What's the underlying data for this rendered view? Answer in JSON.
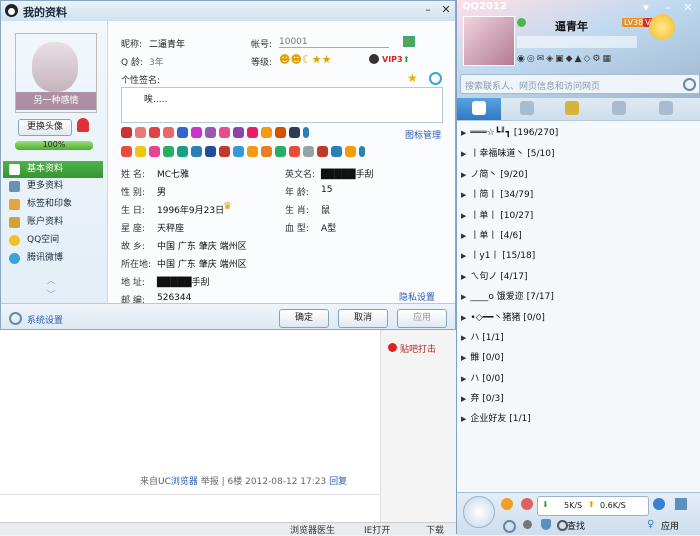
{
  "profile_window": {
    "title": "我的资料",
    "avatar_caption": "另一种感情",
    "change_avatar": "更换头像",
    "completion": "100%",
    "completion_fraction": 1.0,
    "nav": [
      "基本资料",
      "更多资料",
      "标签和印象",
      "账户资料",
      "QQ空间",
      "腾讯微博"
    ],
    "nickname_label": "昵称:",
    "nickname": "二逼青年",
    "account_label": "帐号:",
    "account": "10001",
    "qage_label": "Q 龄:",
    "qage": "3年",
    "level_label": "等级:",
    "vip": "VIP3",
    "signature_label": "个性签名:",
    "signature": "唉.....",
    "icon_manage": "图标管理",
    "fields": {
      "name_label": "姓 名:",
      "name": "MC七雅",
      "en_label": "英文名:",
      "en": "█████手刮",
      "gender_label": "性 别:",
      "gender": "男",
      "age_label": "年 龄:",
      "age": "15",
      "birthday_label": "生 日:",
      "birthday": "1996年9月23日",
      "zodiac_label": "生 肖:",
      "zodiac": "鼠",
      "star_label": "星 座:",
      "star": "天秤座",
      "blood_label": "血 型:",
      "blood": "A型",
      "hometown_label": "故 乡:",
      "hometown": "中国  广东  肇庆  端州区",
      "location_label": "所在地:",
      "location": "中国  广东  肇庆  端州区",
      "address_label": "地 址:",
      "address": "█████手刮",
      "zip_label": "邮 编:",
      "zip": "526344"
    },
    "privacy": "隐私设置",
    "system_settings": "系统设置",
    "ok": "确定",
    "cancel": "取消",
    "apply": "应用"
  },
  "background_page": {
    "footer_source": "来自",
    "footer_browser": "UC浏览器",
    "footer_report": "举报",
    "footer_floor": "| 6楼  2012-08-12 17:23",
    "footer_reply": "回复",
    "tieba": "贴吧打击",
    "statusbar": [
      "浏览器医生",
      "IE打开",
      "下载"
    ]
  },
  "qq_panel": {
    "title": "QQ2012",
    "nickname": "逼青年",
    "level": "LV38",
    "vip": "VIP",
    "search_placeholder": "搜索联系人、网页信息和访问网页",
    "groups": [
      "═══☆┗╜┓  [196/270]",
      "丨幸福味道丶  [5/10]",
      "ノ简丶 [9/20]",
      "丨简丨 [34/79]",
      "丨单丨 [10/27]",
      "丨单丨 [4/6]",
      "丨y1丨 [15/18]",
      "ㄟ句ノ [4/17]",
      "____o 饿爱迩  [7/17]",
      "•◇━━丶猪猪  [0/0]",
      "ハ  [1/1]",
      "雔  [0/0]",
      "ハ  [0/0]",
      "弃  [0/3]",
      "企业好友  [1/1]"
    ],
    "download_speed": "5K/S",
    "upload_speed": "0.6K/S",
    "find": "查找",
    "apply": "应用"
  }
}
